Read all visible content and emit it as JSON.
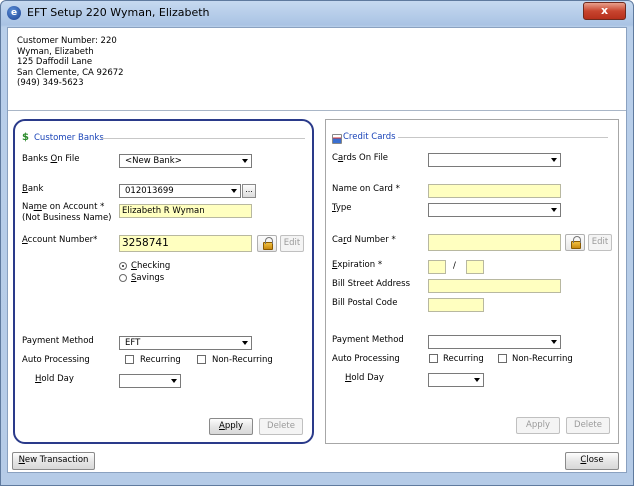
{
  "window": {
    "title": "EFT Setup 220 Wyman, Elizabeth",
    "close_label": "x",
    "icon_name": "app-icon"
  },
  "customer": {
    "number_line": "Customer Number: 220",
    "name": "Wyman, Elizabeth",
    "street": "125 Daffodil Lane",
    "city_line": "San Clemente, CA  92672",
    "phone": "(949) 349-5623"
  },
  "banks": {
    "group_title": "Customer Banks",
    "icon_name": "dollar-icon",
    "banks_on_file_label_pre": "Banks ",
    "banks_on_file_label_u": "O",
    "banks_on_file_label_post": "n File",
    "banks_on_file_value": "<New Bank>",
    "bank_label_u": "B",
    "bank_label_post": "ank",
    "bank_value": "012013699",
    "bank_lookup_label": "...",
    "name_label_pre": "Na",
    "name_label_u": "m",
    "name_label_post": "e on Account *",
    "name_sublabel": "(Not Business Name)",
    "name_value": "Elizabeth R Wyman",
    "account_label_u": "A",
    "account_label_post": "ccount Number*",
    "account_value": "3258741",
    "edit_label": "Edit",
    "checking_label_u": "C",
    "checking_label_post": "hecking",
    "savings_label_u": "S",
    "savings_label_post": "avings",
    "payment_method_label": "Payment Method",
    "payment_method_value": "EFT",
    "auto_processing_label": "Auto Processing",
    "recurring_label": "Recurring",
    "non_recurring_label": "Non-Recurring",
    "hold_day_label_u": "H",
    "hold_day_label_post": "old Day",
    "hold_day_value": "",
    "apply_label_u": "A",
    "apply_label_post": "pply",
    "delete_label": "Delete"
  },
  "cards": {
    "group_title": "Credit Cards",
    "icon_name": "credit-card-icon",
    "cards_on_file_label_pre": "C",
    "cards_on_file_label_u": "a",
    "cards_on_file_label_post": "rds On File",
    "cards_on_file_value": "",
    "name_label": "Name on Card *",
    "type_label_u": "T",
    "type_label_post": "ype",
    "type_value": "",
    "card_number_label_pre": "Ca",
    "card_number_label_u": "r",
    "card_number_label_post": "d Number *",
    "edit_label": "Edit",
    "expiration_label_u": "E",
    "expiration_label_post": "xpiration *",
    "expiration_sep": "/",
    "bill_street_label": "Bill Street Address",
    "bill_postal_label": "Bill Postal Code",
    "payment_method_label": "Payment Method",
    "payment_method_value": "",
    "auto_processing_label": "Auto Processing",
    "recurring_label": "Recurring",
    "non_recurring_label": "Non-Recurring",
    "hold_day_label_u": "H",
    "hold_day_label_post": "old Day",
    "hold_day_value": "",
    "apply_label": "Apply",
    "delete_label": "Delete"
  },
  "footer": {
    "new_transaction_label_u": "N",
    "new_transaction_label_post": "ew Transaction",
    "close_label_u": "C",
    "close_label_post": "lose"
  },
  "colors": {
    "required_field": "#ffffc0",
    "group_title": "#1a44b8",
    "highlight_border": "#2a3a8a"
  }
}
